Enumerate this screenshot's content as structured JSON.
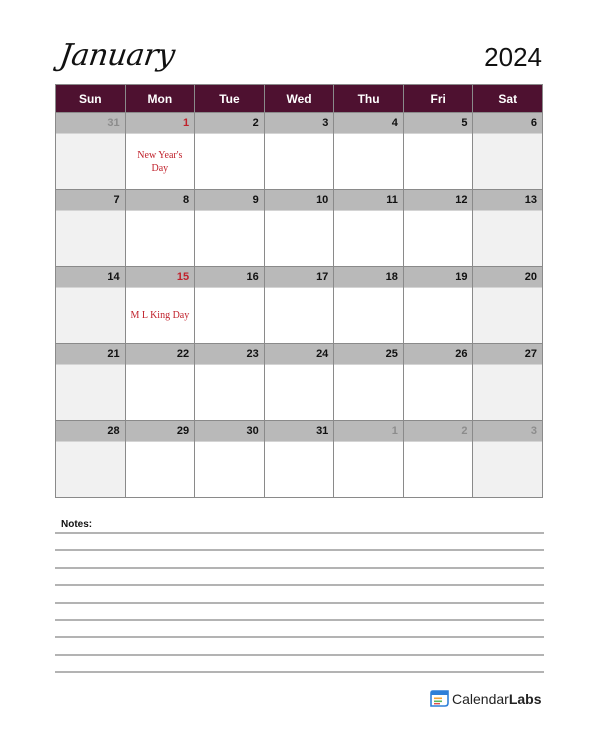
{
  "header": {
    "month": "January",
    "year": "2024"
  },
  "weekdays": [
    "Sun",
    "Mon",
    "Tue",
    "Wed",
    "Thu",
    "Fri",
    "Sat"
  ],
  "weeks": [
    [
      {
        "date": "31",
        "muted": true,
        "holiday": false,
        "event": ""
      },
      {
        "date": "1",
        "muted": false,
        "holiday": true,
        "event": "New Year's Day"
      },
      {
        "date": "2",
        "muted": false,
        "holiday": false,
        "event": ""
      },
      {
        "date": "3",
        "muted": false,
        "holiday": false,
        "event": ""
      },
      {
        "date": "4",
        "muted": false,
        "holiday": false,
        "event": ""
      },
      {
        "date": "5",
        "muted": false,
        "holiday": false,
        "event": ""
      },
      {
        "date": "6",
        "muted": false,
        "holiday": false,
        "event": ""
      }
    ],
    [
      {
        "date": "7",
        "muted": false,
        "holiday": false,
        "event": ""
      },
      {
        "date": "8",
        "muted": false,
        "holiday": false,
        "event": ""
      },
      {
        "date": "9",
        "muted": false,
        "holiday": false,
        "event": ""
      },
      {
        "date": "10",
        "muted": false,
        "holiday": false,
        "event": ""
      },
      {
        "date": "11",
        "muted": false,
        "holiday": false,
        "event": ""
      },
      {
        "date": "12",
        "muted": false,
        "holiday": false,
        "event": ""
      },
      {
        "date": "13",
        "muted": false,
        "holiday": false,
        "event": ""
      }
    ],
    [
      {
        "date": "14",
        "muted": false,
        "holiday": false,
        "event": ""
      },
      {
        "date": "15",
        "muted": false,
        "holiday": true,
        "event": "M L King Day"
      },
      {
        "date": "16",
        "muted": false,
        "holiday": false,
        "event": ""
      },
      {
        "date": "17",
        "muted": false,
        "holiday": false,
        "event": ""
      },
      {
        "date": "18",
        "muted": false,
        "holiday": false,
        "event": ""
      },
      {
        "date": "19",
        "muted": false,
        "holiday": false,
        "event": ""
      },
      {
        "date": "20",
        "muted": false,
        "holiday": false,
        "event": ""
      }
    ],
    [
      {
        "date": "21",
        "muted": false,
        "holiday": false,
        "event": ""
      },
      {
        "date": "22",
        "muted": false,
        "holiday": false,
        "event": ""
      },
      {
        "date": "23",
        "muted": false,
        "holiday": false,
        "event": ""
      },
      {
        "date": "24",
        "muted": false,
        "holiday": false,
        "event": ""
      },
      {
        "date": "25",
        "muted": false,
        "holiday": false,
        "event": ""
      },
      {
        "date": "26",
        "muted": false,
        "holiday": false,
        "event": ""
      },
      {
        "date": "27",
        "muted": false,
        "holiday": false,
        "event": ""
      }
    ],
    [
      {
        "date": "28",
        "muted": false,
        "holiday": false,
        "event": ""
      },
      {
        "date": "29",
        "muted": false,
        "holiday": false,
        "event": ""
      },
      {
        "date": "30",
        "muted": false,
        "holiday": false,
        "event": ""
      },
      {
        "date": "31",
        "muted": false,
        "holiday": false,
        "event": ""
      },
      {
        "date": "1",
        "muted": true,
        "holiday": false,
        "event": ""
      },
      {
        "date": "2",
        "muted": true,
        "holiday": false,
        "event": ""
      },
      {
        "date": "3",
        "muted": true,
        "holiday": false,
        "event": ""
      }
    ]
  ],
  "notes": {
    "label": "Notes:",
    "line_count": 9
  },
  "brand": {
    "name_regular": "Calendar",
    "name_bold": "Labs",
    "icon": "calendar-logo-icon"
  },
  "colors": {
    "header_bg": "#4e1130",
    "date_bar": "#b9b9b9",
    "holiday": "#c0222c",
    "weekend_bg": "#f1f1f1"
  }
}
